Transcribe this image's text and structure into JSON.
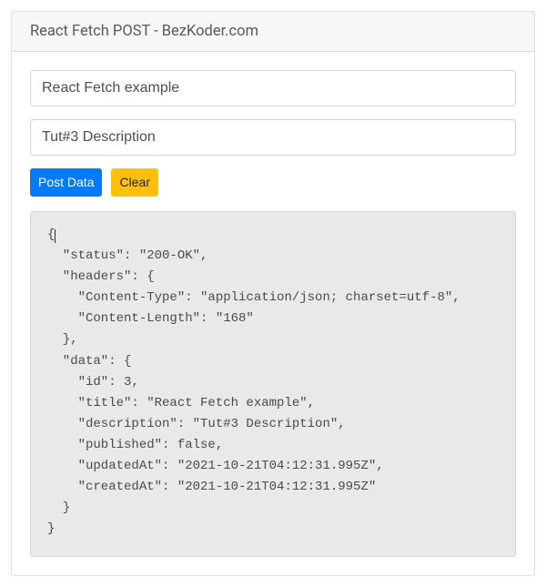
{
  "header": {
    "title": "React Fetch POST - BezKoder.com"
  },
  "form": {
    "title_value": "React Fetch example",
    "description_value": "Tut#3 Description"
  },
  "buttons": {
    "post_label": "Post Data",
    "clear_label": "Clear"
  },
  "response_text": "{\n  \"status\": \"200-OK\",\n  \"headers\": {\n    \"Content-Type\": \"application/json; charset=utf-8\",\n    \"Content-Length\": \"168\"\n  },\n  \"data\": {\n    \"id\": 3,\n    \"title\": \"React Fetch example\",\n    \"description\": \"Tut#3 Description\",\n    \"published\": false,\n    \"updatedAt\": \"2021-10-21T04:12:31.995Z\",\n    \"createdAt\": \"2021-10-21T04:12:31.995Z\"\n  }\n}"
}
